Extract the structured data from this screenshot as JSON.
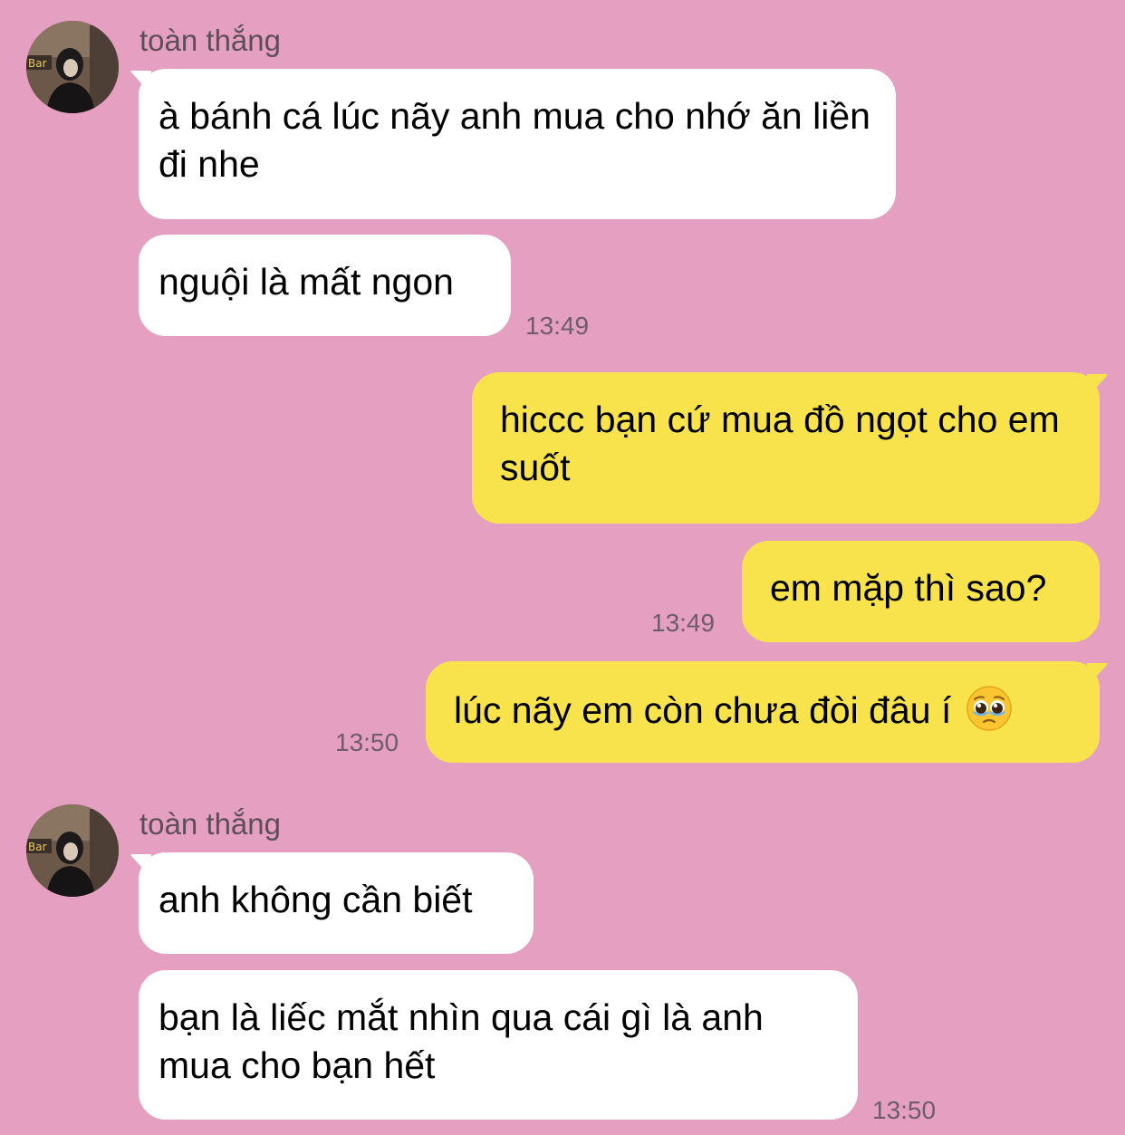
{
  "conversation": {
    "contact_name": "toàn thắng",
    "groups": [
      {
        "sender_name": "toàn thắng",
        "messages": [
          "à bánh cá lúc nãy anh mua cho nhớ ăn liền đi nhe",
          "nguội là mất ngon"
        ],
        "timestamp": "13:49"
      },
      {
        "messages": [
          "hiccc bạn cứ mua đồ ngọt cho em suốt",
          "em mặp thì sao?"
        ],
        "timestamp": "13:49"
      },
      {
        "messages": [
          "lúc nãy em còn chưa đòi đâu í"
        ],
        "emoji": "pleading-face-icon",
        "timestamp": "13:50"
      },
      {
        "sender_name": "toàn thắng",
        "messages": [
          "anh không cần biết",
          "bạn là liếc mắt nhìn qua cái gì là anh mua cho bạn hết"
        ],
        "timestamp": "13:50"
      }
    ]
  },
  "colors": {
    "background": "#e59fc0",
    "incoming_bubble": "#ffffff",
    "outgoing_bubble": "#f9e34d",
    "timestamp_text": "#6e5d69",
    "sender_name_text": "#5d4f58"
  }
}
